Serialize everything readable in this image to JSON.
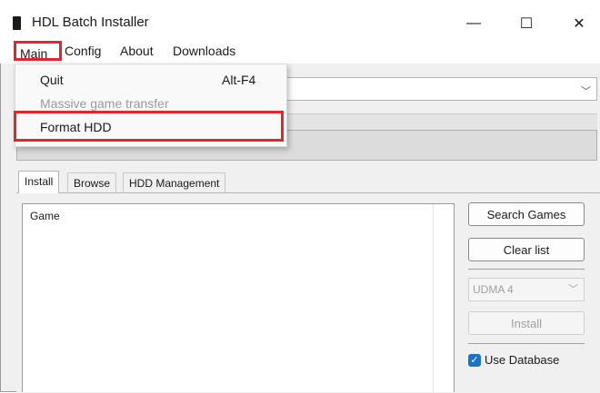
{
  "window": {
    "title": "HDL Batch Installer",
    "controls": {
      "minimize": "—",
      "maximize": "☐",
      "close": "✕"
    }
  },
  "menubar": {
    "items": [
      {
        "label": "Main"
      },
      {
        "label": "Config"
      },
      {
        "label": "About"
      },
      {
        "label": "Downloads"
      }
    ]
  },
  "main_menu": {
    "items": [
      {
        "label": "Quit",
        "shortcut": "Alt-F4",
        "enabled": true
      },
      {
        "label": "Massive game transfer",
        "enabled": false
      },
      {
        "label": "Format HDD",
        "enabled": true
      }
    ]
  },
  "tabs": [
    {
      "label": "Install",
      "active": true
    },
    {
      "label": "Browse",
      "active": false
    },
    {
      "label": "HDD Management",
      "active": false
    }
  ],
  "game_list": {
    "header": "Game"
  },
  "side_panel": {
    "search_button": "Search Games",
    "clear_button": "Clear list",
    "mode_select": "UDMA 4",
    "install_button": "Install",
    "use_database_label": "Use Database",
    "use_database_checked": true
  },
  "icons": {
    "combo_chevron": "chevron-down-icon",
    "checkbox_check": "check-icon"
  },
  "colors": {
    "highlight_red": "#e1262d",
    "checkbox_blue": "#1a73c9"
  }
}
